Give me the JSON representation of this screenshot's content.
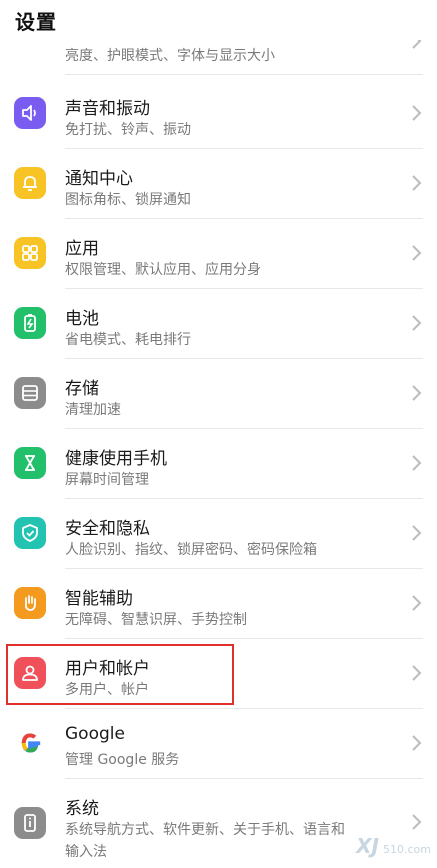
{
  "header": {
    "title": "设置"
  },
  "items": [
    {
      "id": "display",
      "label": "",
      "sub": "亮度、护眼模式、字体与显示大小",
      "color": "#2fc25b",
      "icon": "display-icon"
    },
    {
      "id": "sound",
      "label": "声音和振动",
      "sub": "免打扰、铃声、振动",
      "color": "#7b5cf0",
      "icon": "speaker-icon"
    },
    {
      "id": "notify",
      "label": "通知中心",
      "sub": "图标角标、锁屏通知",
      "color": "#f7c325",
      "icon": "bell-icon"
    },
    {
      "id": "apps",
      "label": "应用",
      "sub": "权限管理、默认应用、应用分身",
      "color": "#f7c325",
      "icon": "apps-grid-icon"
    },
    {
      "id": "battery",
      "label": "电池",
      "sub": "省电模式、耗电排行",
      "color": "#22c06a",
      "icon": "battery-icon"
    },
    {
      "id": "storage",
      "label": "存储",
      "sub": "清理加速",
      "color": "#8c8c8c",
      "icon": "storage-icon"
    },
    {
      "id": "health",
      "label": "健康使用手机",
      "sub": "屏幕时间管理",
      "color": "#22c06a",
      "icon": "hourglass-icon"
    },
    {
      "id": "security",
      "label": "安全和隐私",
      "sub": "人脸识别、指纹、锁屏密码、密码保险箱",
      "color": "#22c3b0",
      "icon": "shield-icon"
    },
    {
      "id": "assist",
      "label": "智能辅助",
      "sub": "无障碍、智慧识屏、手势控制",
      "color": "#f39a1f",
      "icon": "hand-icon"
    },
    {
      "id": "accounts",
      "label": "用户和帐户",
      "sub": "多用户、帐户",
      "color": "#f0505a",
      "icon": "user-icon"
    },
    {
      "id": "google",
      "label": "Google",
      "sub": "管理 Google 服务",
      "color": "#ffffff",
      "icon": "google-icon"
    },
    {
      "id": "system",
      "label": "系统",
      "sub": "系统导航方式、软件更新、关于手机、语言和",
      "sub2": "输入法",
      "color": "#8c8c8c",
      "icon": "phone-info-icon"
    }
  ],
  "watermark": {
    "logo": "XJ",
    "site": "510.com"
  }
}
